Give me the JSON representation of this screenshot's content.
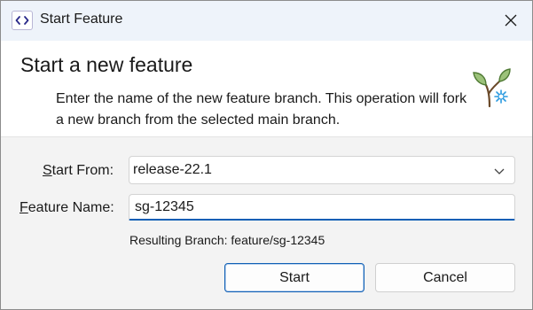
{
  "window": {
    "title": "Start Feature",
    "app_icon_glyph": "<>",
    "accent_color": "#0f5fb5"
  },
  "header": {
    "heading": "Start a new feature",
    "description": "Enter the name of the new feature branch. This operation will fork a new branch from the selected main branch.",
    "icon": "sprout-icon"
  },
  "form": {
    "start_from": {
      "label_prefix": "S",
      "label_rest": "tart From:",
      "selected": "release-22.1"
    },
    "feature_name": {
      "label_prefix": "F",
      "label_rest": "eature Name:",
      "value": "sg-12345"
    },
    "resulting_branch": "Resulting Branch: feature/sg-12345"
  },
  "buttons": {
    "start": "Start",
    "cancel": "Cancel"
  }
}
